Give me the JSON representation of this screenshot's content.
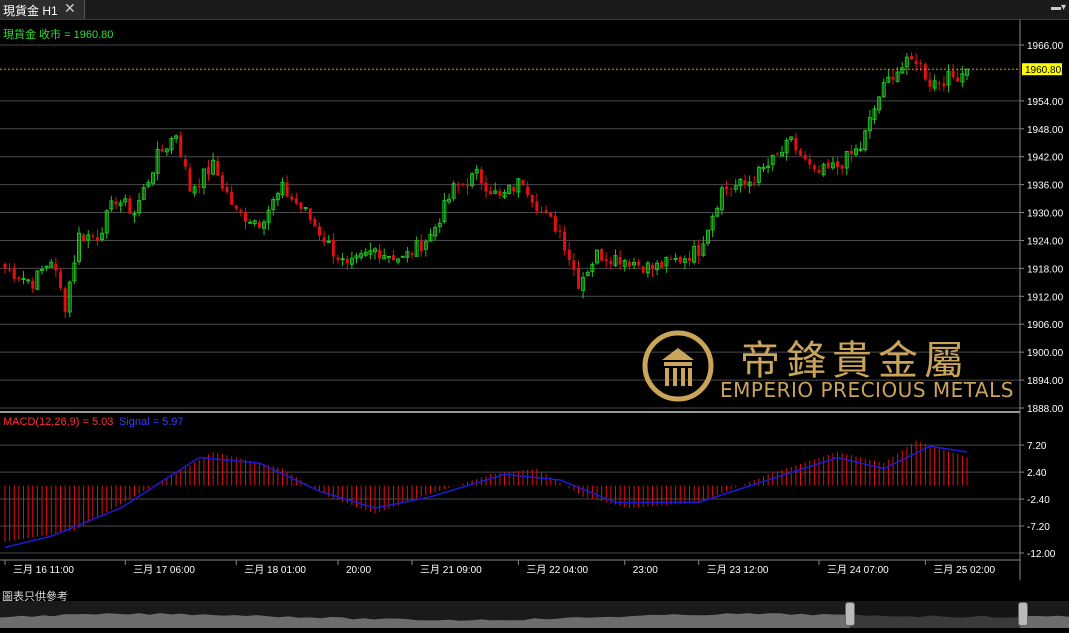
{
  "window": {
    "tab_title": "現貨金 H1",
    "close_glyph": "✕",
    "menu_glyph": "▬▾"
  },
  "price_panel": {
    "legend": "現貨金 收市 = 1960.80",
    "current_price": "1960.80",
    "y_ticks": [
      "1966.00",
      "1960.80",
      "1954.00",
      "1948.00",
      "1942.00",
      "1936.00",
      "1930.00",
      "1924.00",
      "1918.00",
      "1912.00",
      "1906.00",
      "1900.00",
      "1894.00",
      "1888.00"
    ]
  },
  "macd_panel": {
    "legend_main": "MACD(12,26,9) = 5.03",
    "legend_signal": "Signal = 5.97",
    "y_ticks": [
      "7.20",
      "2.40",
      "-2.40",
      "-7.20",
      "-12.00"
    ]
  },
  "x_axis": {
    "ticks": [
      "三月 16 11:00",
      "三月 17 06:00",
      "三月 18 01:00",
      "20:00",
      "三月 21 09:00",
      "三月 22 04:00",
      "23:00",
      "三月 23 12:00",
      "三月 24 07:00",
      "三月 25 02:00"
    ]
  },
  "footer": {
    "note": "圖表只供參考"
  },
  "watermark": {
    "chinese": "帝鋒貴金屬",
    "english": "EMPERIO PRECIOUS METALS"
  },
  "colors": {
    "up": "#1fc21f",
    "down": "#e01010",
    "signal": "#1b1bd6",
    "macd_bar": "#e01010",
    "grid": "#4a4a4a",
    "axis_text": "#ffffff",
    "price_tag": "#ffff00",
    "legend_green": "#33dd33"
  },
  "chart_data": {
    "type": "candlestick",
    "title": "現貨金 H1",
    "price_range": [
      1888,
      1968
    ],
    "close_anchors": [
      [
        0,
        1918
      ],
      [
        6,
        1915
      ],
      [
        10,
        1920
      ],
      [
        13,
        1910
      ],
      [
        16,
        1925
      ],
      [
        20,
        1925
      ],
      [
        24,
        1933
      ],
      [
        28,
        1930
      ],
      [
        33,
        1942
      ],
      [
        37,
        1947
      ],
      [
        40,
        1935
      ],
      [
        45,
        1940
      ],
      [
        50,
        1930
      ],
      [
        55,
        1928
      ],
      [
        60,
        1935
      ],
      [
        65,
        1930
      ],
      [
        70,
        1923
      ],
      [
        74,
        1918
      ],
      [
        80,
        1922
      ],
      [
        86,
        1920
      ],
      [
        92,
        1925
      ],
      [
        97,
        1935
      ],
      [
        102,
        1938
      ],
      [
        107,
        1933
      ],
      [
        112,
        1937
      ],
      [
        116,
        1930
      ],
      [
        120,
        1926
      ],
      [
        124,
        1915
      ],
      [
        128,
        1921
      ],
      [
        134,
        1920
      ],
      [
        140,
        1918
      ],
      [
        146,
        1920
      ],
      [
        150,
        1922
      ],
      [
        155,
        1935
      ],
      [
        160,
        1936
      ],
      [
        165,
        1940
      ],
      [
        170,
        1945
      ],
      [
        175,
        1938
      ],
      [
        180,
        1940
      ],
      [
        185,
        1944
      ],
      [
        189,
        1955
      ],
      [
        192,
        1960
      ],
      [
        197,
        1963
      ],
      [
        200,
        1958
      ],
      [
        205,
        1959
      ],
      [
        208,
        1960.8
      ]
    ],
    "macd_range": [
      -12,
      9
    ],
    "macd_anchors": [
      [
        0,
        -10
      ],
      [
        15,
        -8
      ],
      [
        30,
        -1
      ],
      [
        45,
        6
      ],
      [
        60,
        3
      ],
      [
        70,
        -2
      ],
      [
        80,
        -5
      ],
      [
        90,
        -2
      ],
      [
        105,
        2
      ],
      [
        115,
        3
      ],
      [
        125,
        -2
      ],
      [
        135,
        -4
      ],
      [
        150,
        -3
      ],
      [
        165,
        2
      ],
      [
        180,
        6
      ],
      [
        190,
        4
      ],
      [
        197,
        8
      ],
      [
        208,
        5.03
      ]
    ],
    "signal_anchors": [
      [
        0,
        -11
      ],
      [
        10,
        -9
      ],
      [
        25,
        -4
      ],
      [
        42,
        5
      ],
      [
        55,
        4
      ],
      [
        68,
        -1
      ],
      [
        80,
        -4
      ],
      [
        92,
        -2
      ],
      [
        108,
        2
      ],
      [
        120,
        1
      ],
      [
        132,
        -3
      ],
      [
        150,
        -3
      ],
      [
        165,
        1
      ],
      [
        180,
        5
      ],
      [
        190,
        3
      ],
      [
        200,
        7
      ],
      [
        208,
        5.97
      ]
    ]
  }
}
